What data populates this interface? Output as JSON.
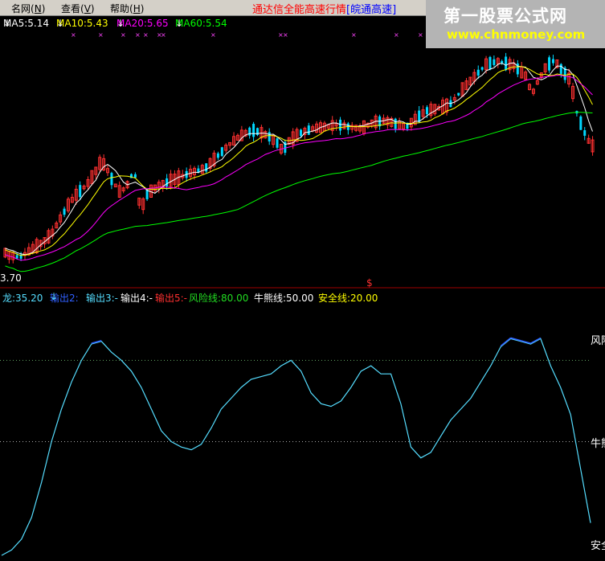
{
  "menu": {
    "items": [
      {
        "label": "名网",
        "key": "N"
      },
      {
        "label": "查看",
        "key": "V"
      },
      {
        "label": "帮助",
        "key": "H"
      }
    ],
    "marquee": "通达信全能高速行情",
    "marquee_tag": "[皖通高速]"
  },
  "watermark": {
    "title": "第一股票公式网",
    "url": "www.chnmoney.com"
  },
  "main_chart": {
    "ma_legend": [
      {
        "label": "MA5:5.14",
        "color": "#ffffff"
      },
      {
        "label": "MA10:5.43",
        "color": "#ffff00"
      },
      {
        "label": "MA20:5.65",
        "color": "#ff00ff"
      },
      {
        "label": "MA60:5.54",
        "color": "#00ff00"
      }
    ],
    "low_price_label": "3.70",
    "marker_label": "$"
  },
  "indicator": {
    "legend": [
      {
        "label": "龙:35.20",
        "color": "#55ddff"
      },
      {
        "label": "输出2:",
        "color": "#3060ff"
      },
      {
        "label": "输出3:-",
        "color": "#55ddff"
      },
      {
        "label": "输出4:-",
        "color": "#ffffff"
      },
      {
        "label": "输出5:-",
        "color": "#ff3030"
      },
      {
        "label": "风险线:80.00",
        "color": "#22dd22"
      },
      {
        "label": "牛熊线:50.00",
        "color": "#ffffff"
      },
      {
        "label": "安全线:20.00",
        "color": "#ffff00"
      }
    ],
    "right_labels": {
      "risk": "风险",
      "bull": "牛熊",
      "safe": "安全"
    },
    "levels": {
      "risk": 80,
      "bull": 50,
      "safe": 20
    },
    "series_values": [
      8,
      10,
      14,
      22,
      35,
      50,
      62,
      72,
      80,
      86,
      87,
      83,
      80,
      76,
      70,
      62,
      54,
      50,
      48,
      47,
      49,
      55,
      62,
      66,
      70,
      73,
      74,
      75,
      78,
      80,
      76,
      68,
      64,
      63,
      65,
      70,
      76,
      78,
      75,
      75,
      64,
      48,
      44,
      46,
      52,
      58,
      62,
      66,
      72,
      78,
      85,
      88,
      87,
      86,
      88,
      78,
      70,
      60,
      40,
      20
    ]
  },
  "colors": {
    "up": "#ff3030",
    "down": "#00d8ff",
    "ma5": "#ffffff",
    "ma10": "#ffff00",
    "ma20": "#ff00ff",
    "ma60": "#00ff00",
    "line": "#55ddff"
  }
}
